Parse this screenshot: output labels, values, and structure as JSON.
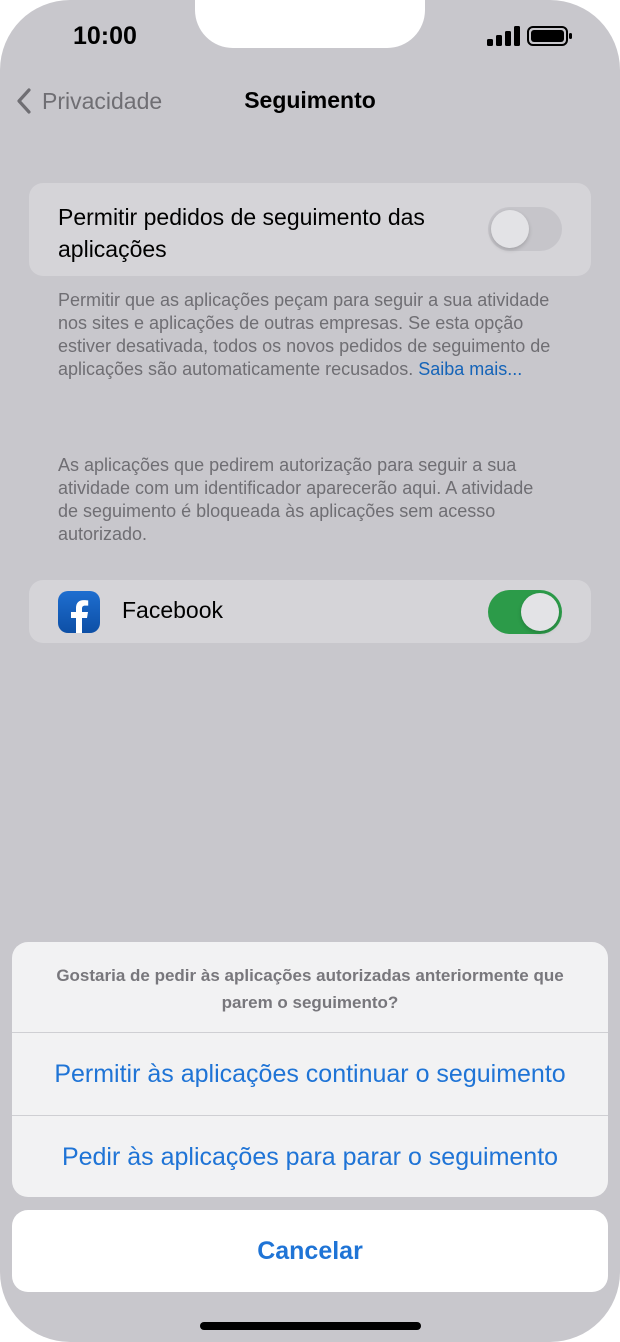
{
  "status_bar": {
    "time": "10:00"
  },
  "nav": {
    "back_label": "Privacidade",
    "title": "Seguimento"
  },
  "tracking_setting": {
    "label": "Permitir pedidos de seguimento das aplicações",
    "toggle_state": "off"
  },
  "description": {
    "text": "Permitir que as aplicações peçam para seguir a sua atividade nos sites e aplicações de outras empresas. Se esta opção estiver desativada, todos os novos pedidos de seguimento de aplicações são automaticamente recusados.",
    "link": "Saiba mais..."
  },
  "apps_info": "As aplicações que pedirem autorização para seguir a sua atividade com um identificador aparecerão aqui. A atividade de seguimento é bloqueada às aplicações sem acesso autorizado.",
  "apps": [
    {
      "name": "Facebook",
      "icon": "facebook-icon",
      "toggle_state": "on"
    }
  ],
  "action_sheet": {
    "message": "Gostaria de pedir às aplicações autorizadas anteriormente que parem o seguimento?",
    "allow_button": "Permitir às aplicações continuar o seguimento",
    "ask_stop_button": "Pedir às aplicações para parar o seguimento",
    "cancel_button": "Cancelar"
  },
  "colors": {
    "accent": "#1f74d6",
    "toggle_on": "#2c9b49",
    "link": "#1564b8"
  }
}
